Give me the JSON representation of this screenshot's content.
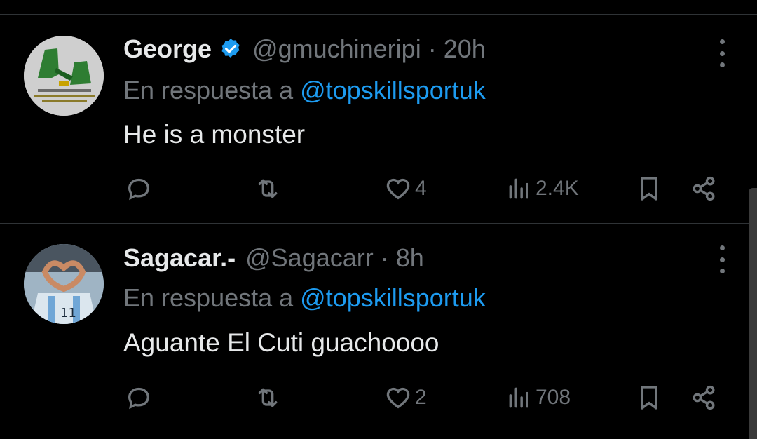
{
  "tweets": [
    {
      "display_name": "George",
      "verified": true,
      "handle": "@gmuchineripi",
      "time": "20h",
      "reply_prefix": "En respuesta a",
      "reply_to": "@topskillsportuk",
      "text": "He is a monster",
      "stats": {
        "likes": "4",
        "views": "2.4K"
      }
    },
    {
      "display_name": "Sagacar.-",
      "verified": false,
      "handle": "@Sagacarr",
      "time": "8h",
      "reply_prefix": "En respuesta a",
      "reply_to": "@topskillsportuk",
      "text": "Aguante El Cuti guachoooo",
      "stats": {
        "likes": "2",
        "views": "708"
      }
    }
  ],
  "colors": {
    "background": "#000000",
    "primary_text": "#e7e9ea",
    "secondary_text": "#71767b",
    "link": "#1d9bf0",
    "divider": "#2f3336"
  },
  "icons": [
    "verified-badge-icon",
    "more-options-icon",
    "reply-icon",
    "retweet-icon",
    "like-icon",
    "views-icon",
    "bookmark-icon",
    "share-icon"
  ]
}
